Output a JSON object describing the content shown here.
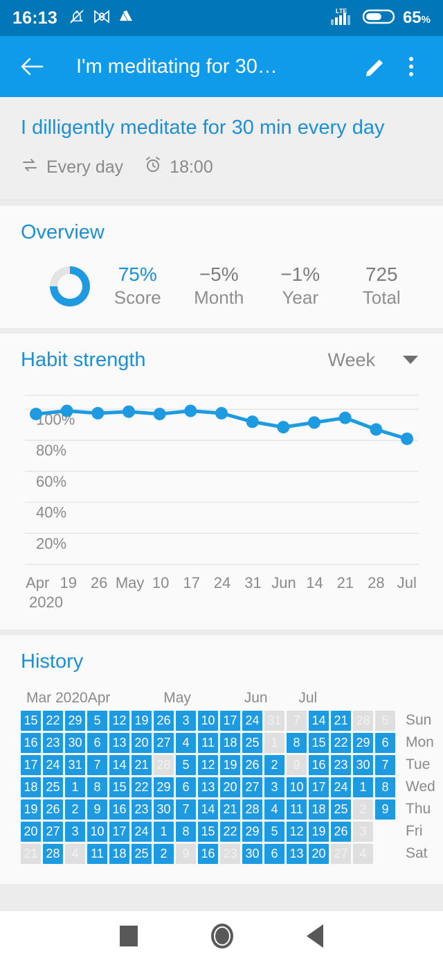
{
  "statusbar": {
    "time": "16:13",
    "battery_text": "65",
    "battery_unit": "%",
    "network": "LTE",
    "icons": [
      "bell-off-icon",
      "butterfly-icon",
      "drive-icon"
    ]
  },
  "appbar": {
    "title": "I'm meditating for 30…",
    "back_label": "Back",
    "edit_label": "Edit",
    "more_label": "More options"
  },
  "habit": {
    "question": "I dilligently meditate for 30 min every day",
    "frequency": "Every day",
    "reminder": "18:00"
  },
  "overview": {
    "title": "Overview",
    "score_percent": 75,
    "stats": [
      {
        "value": "75%",
        "label": "Score",
        "accent": true
      },
      {
        "value": "−5%",
        "label": "Month",
        "accent": false
      },
      {
        "value": "−1%",
        "label": "Year",
        "accent": false
      },
      {
        "value": "725",
        "label": "Total",
        "accent": false
      }
    ]
  },
  "habit_strength": {
    "title": "Habit strength",
    "period_selected": "Week",
    "year_label": "2020"
  },
  "history": {
    "title": "History",
    "months": [
      "Mar 2020",
      "Apr",
      "May",
      "Jun",
      "Jul"
    ],
    "daylabels": [
      "Sun",
      "Mon",
      "Tue",
      "Wed",
      "Thu",
      "Fri",
      "Sat"
    ],
    "rows": [
      {
        "day": "Sun",
        "cells": [
          {
            "d": "15",
            "s": "on"
          },
          {
            "d": "22",
            "s": "on"
          },
          {
            "d": "29",
            "s": "on"
          },
          {
            "d": "5",
            "s": "on"
          },
          {
            "d": "12",
            "s": "on"
          },
          {
            "d": "19",
            "s": "on"
          },
          {
            "d": "26",
            "s": "on"
          },
          {
            "d": "3",
            "s": "on"
          },
          {
            "d": "10",
            "s": "on"
          },
          {
            "d": "17",
            "s": "on"
          },
          {
            "d": "24",
            "s": "on"
          },
          {
            "d": "31",
            "s": "off"
          },
          {
            "d": "7",
            "s": "off"
          },
          {
            "d": "14",
            "s": "on"
          },
          {
            "d": "21",
            "s": "on"
          },
          {
            "d": "28",
            "s": "off"
          },
          {
            "d": "5",
            "s": "off"
          }
        ]
      },
      {
        "day": "Mon",
        "cells": [
          {
            "d": "16",
            "s": "on"
          },
          {
            "d": "23",
            "s": "on"
          },
          {
            "d": "30",
            "s": "on"
          },
          {
            "d": "6",
            "s": "on"
          },
          {
            "d": "13",
            "s": "on"
          },
          {
            "d": "20",
            "s": "on"
          },
          {
            "d": "27",
            "s": "on"
          },
          {
            "d": "4",
            "s": "on"
          },
          {
            "d": "11",
            "s": "on"
          },
          {
            "d": "18",
            "s": "on"
          },
          {
            "d": "25",
            "s": "on"
          },
          {
            "d": "1",
            "s": "off"
          },
          {
            "d": "8",
            "s": "on"
          },
          {
            "d": "15",
            "s": "on"
          },
          {
            "d": "22",
            "s": "on"
          },
          {
            "d": "29",
            "s": "on"
          },
          {
            "d": "6",
            "s": "on"
          }
        ]
      },
      {
        "day": "Tue",
        "cells": [
          {
            "d": "17",
            "s": "on"
          },
          {
            "d": "24",
            "s": "on"
          },
          {
            "d": "31",
            "s": "on"
          },
          {
            "d": "7",
            "s": "on"
          },
          {
            "d": "14",
            "s": "on"
          },
          {
            "d": "21",
            "s": "on"
          },
          {
            "d": "28",
            "s": "off"
          },
          {
            "d": "5",
            "s": "on"
          },
          {
            "d": "12",
            "s": "on"
          },
          {
            "d": "19",
            "s": "on"
          },
          {
            "d": "26",
            "s": "on"
          },
          {
            "d": "2",
            "s": "on"
          },
          {
            "d": "9",
            "s": "off"
          },
          {
            "d": "16",
            "s": "on"
          },
          {
            "d": "23",
            "s": "on"
          },
          {
            "d": "30",
            "s": "on"
          },
          {
            "d": "7",
            "s": "on"
          }
        ]
      },
      {
        "day": "Wed",
        "cells": [
          {
            "d": "18",
            "s": "on"
          },
          {
            "d": "25",
            "s": "on"
          },
          {
            "d": "1",
            "s": "on"
          },
          {
            "d": "8",
            "s": "on"
          },
          {
            "d": "15",
            "s": "on"
          },
          {
            "d": "22",
            "s": "on"
          },
          {
            "d": "29",
            "s": "on"
          },
          {
            "d": "6",
            "s": "on"
          },
          {
            "d": "13",
            "s": "on"
          },
          {
            "d": "20",
            "s": "on"
          },
          {
            "d": "27",
            "s": "on"
          },
          {
            "d": "3",
            "s": "on"
          },
          {
            "d": "10",
            "s": "on"
          },
          {
            "d": "17",
            "s": "on"
          },
          {
            "d": "24",
            "s": "on"
          },
          {
            "d": "1",
            "s": "on"
          },
          {
            "d": "8",
            "s": "on"
          }
        ]
      },
      {
        "day": "Thu",
        "cells": [
          {
            "d": "19",
            "s": "on"
          },
          {
            "d": "26",
            "s": "on"
          },
          {
            "d": "2",
            "s": "on"
          },
          {
            "d": "9",
            "s": "on"
          },
          {
            "d": "16",
            "s": "on"
          },
          {
            "d": "23",
            "s": "on"
          },
          {
            "d": "30",
            "s": "on"
          },
          {
            "d": "7",
            "s": "on"
          },
          {
            "d": "14",
            "s": "on"
          },
          {
            "d": "21",
            "s": "on"
          },
          {
            "d": "28",
            "s": "on"
          },
          {
            "d": "4",
            "s": "on"
          },
          {
            "d": "11",
            "s": "on"
          },
          {
            "d": "18",
            "s": "on"
          },
          {
            "d": "25",
            "s": "on"
          },
          {
            "d": "2",
            "s": "off"
          },
          {
            "d": "9",
            "s": "on"
          }
        ]
      },
      {
        "day": "Fri",
        "cells": [
          {
            "d": "20",
            "s": "on"
          },
          {
            "d": "27",
            "s": "on"
          },
          {
            "d": "3",
            "s": "on"
          },
          {
            "d": "10",
            "s": "on"
          },
          {
            "d": "17",
            "s": "on"
          },
          {
            "d": "24",
            "s": "on"
          },
          {
            "d": "1",
            "s": "on"
          },
          {
            "d": "8",
            "s": "on"
          },
          {
            "d": "15",
            "s": "on"
          },
          {
            "d": "22",
            "s": "on"
          },
          {
            "d": "29",
            "s": "on"
          },
          {
            "d": "5",
            "s": "on"
          },
          {
            "d": "12",
            "s": "on"
          },
          {
            "d": "19",
            "s": "on"
          },
          {
            "d": "26",
            "s": "on"
          },
          {
            "d": "3",
            "s": "off"
          },
          {
            "d": "",
            "s": "empty"
          }
        ]
      },
      {
        "day": "Sat",
        "cells": [
          {
            "d": "21",
            "s": "off"
          },
          {
            "d": "28",
            "s": "on"
          },
          {
            "d": "4",
            "s": "off"
          },
          {
            "d": "11",
            "s": "on"
          },
          {
            "d": "18",
            "s": "on"
          },
          {
            "d": "25",
            "s": "on"
          },
          {
            "d": "2",
            "s": "on"
          },
          {
            "d": "9",
            "s": "off"
          },
          {
            "d": "16",
            "s": "on"
          },
          {
            "d": "23",
            "s": "off"
          },
          {
            "d": "30",
            "s": "on"
          },
          {
            "d": "6",
            "s": "on"
          },
          {
            "d": "13",
            "s": "on"
          },
          {
            "d": "20",
            "s": "on"
          },
          {
            "d": "27",
            "s": "off"
          },
          {
            "d": "4",
            "s": "off"
          },
          {
            "d": "",
            "s": "empty"
          }
        ]
      }
    ]
  },
  "navbar": {
    "recents_label": "Recents",
    "home_label": "Home",
    "back_label": "Back"
  },
  "colors": {
    "accent": "#1d9ae0",
    "appbar": "#0f9aea",
    "statusbar": "#0277b8",
    "muted": "#8a8a8a",
    "off_cell": "#dfdfdf"
  },
  "chart_data": {
    "type": "line",
    "title": "Habit strength",
    "xlabel": "",
    "ylabel": "",
    "ylim": [
      0,
      110
    ],
    "grid": true,
    "legend": "none",
    "yticks": [
      100,
      80,
      60,
      40,
      20
    ],
    "ytick_labels": [
      "100%",
      "80%",
      "60%",
      "40%",
      "20%"
    ],
    "categories": [
      "Apr",
      "19",
      "26",
      "May",
      "10",
      "17",
      "24",
      "31",
      "Jun",
      "14",
      "21",
      "28",
      "Jul"
    ],
    "year_label": "2020",
    "values": [
      97,
      99,
      97.5,
      98.5,
      97,
      99,
      97.5,
      92,
      88.5,
      91.5,
      94.5,
      87,
      81
    ]
  }
}
